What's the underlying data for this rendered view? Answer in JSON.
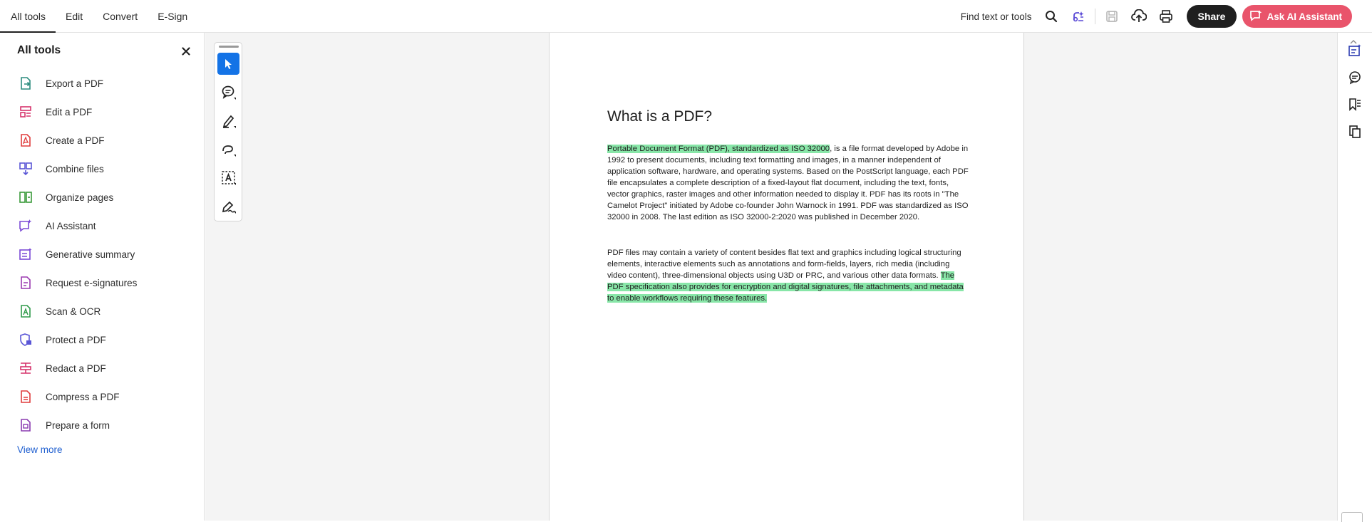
{
  "menu": {
    "items": [
      "All tools",
      "Edit",
      "Convert",
      "E-Sign"
    ]
  },
  "toolbar": {
    "find_label": "Find text or tools",
    "icons": [
      "search-icon",
      "ai-generative-icon",
      "save-icon",
      "upload-cloud-icon",
      "print-icon"
    ],
    "share_label": "Share",
    "ai_label": "Ask AI Assistant"
  },
  "sidebar": {
    "title": "All tools",
    "tools": [
      {
        "label": "Export a PDF",
        "icon": "export-pdf-icon",
        "color": "#2c8c7e"
      },
      {
        "label": "Edit a PDF",
        "icon": "edit-pdf-icon",
        "color": "#d6336c"
      },
      {
        "label": "Create a PDF",
        "icon": "create-pdf-icon",
        "color": "#e03c3c"
      },
      {
        "label": "Combine files",
        "icon": "combine-files-icon",
        "color": "#5a56d6"
      },
      {
        "label": "Organize pages",
        "icon": "organize-pages-icon",
        "color": "#3a9a3a"
      },
      {
        "label": "AI Assistant",
        "icon": "ai-assistant-icon",
        "color": "#7b4ad6"
      },
      {
        "label": "Generative summary",
        "icon": "generative-summary-icon",
        "color": "#7b4ad6"
      },
      {
        "label": "Request e-signatures",
        "icon": "e-signature-icon",
        "color": "#9b3ab0"
      },
      {
        "label": "Scan & OCR",
        "icon": "scan-ocr-icon",
        "color": "#2f9a4a"
      },
      {
        "label": "Protect a PDF",
        "icon": "protect-pdf-icon",
        "color": "#5a56d6"
      },
      {
        "label": "Redact a PDF",
        "icon": "redact-pdf-icon",
        "color": "#d6336c"
      },
      {
        "label": "Compress a PDF",
        "icon": "compress-pdf-icon",
        "color": "#e03c3c"
      },
      {
        "label": "Prepare a form",
        "icon": "prepare-form-icon",
        "color": "#8a3ab0"
      }
    ],
    "view_more": "View more"
  },
  "quick_tools": [
    "select-cursor-icon",
    "comment-icon",
    "highlight-pen-icon",
    "draw-freehand-icon",
    "text-select-icon",
    "sign-pen-icon"
  ],
  "document": {
    "title": "What is a PDF?",
    "p1_highlight": "Portable Document Format (PDF), standardized as ISO 32000",
    "p1_rest": ", is a file format developed by Adobe in 1992 to present documents, including text formatting and images, in a manner independent of application software, hardware, and operating systems. Based on the PostScript language, each PDF file encapsulates a complete description of a fixed-layout flat document, including the text, fonts, vector graphics, raster images and other information needed to display it. PDF has its roots in \"The Camelot Project\" initiated by Adobe co-founder John Warnock in 1991. PDF was standardized as ISO 32000 in 2008. The last edition as ISO 32000-2:2020 was published in December 2020.",
    "p2_start": "PDF files may contain a variety of content besides flat text and graphics including logical structuring elements, interactive elements such as annotations and form-fields, layers, rich media (including video content), three-dimensional objects using U3D or PRC, and various other data formats. ",
    "p2_highlight": "The PDF specification also provides for encryption and digital signatures, file attachments, and metadata to enable workflows requiring these features."
  },
  "right_rail": [
    "ai-summary-icon",
    "comments-panel-icon",
    "bookmarks-icon",
    "pages-panel-icon"
  ],
  "colors": {
    "highlight": "#88e6a8",
    "accent_blue": "#1473e6",
    "ai_button": "#e9546b",
    "link": "#1f5fd0"
  }
}
